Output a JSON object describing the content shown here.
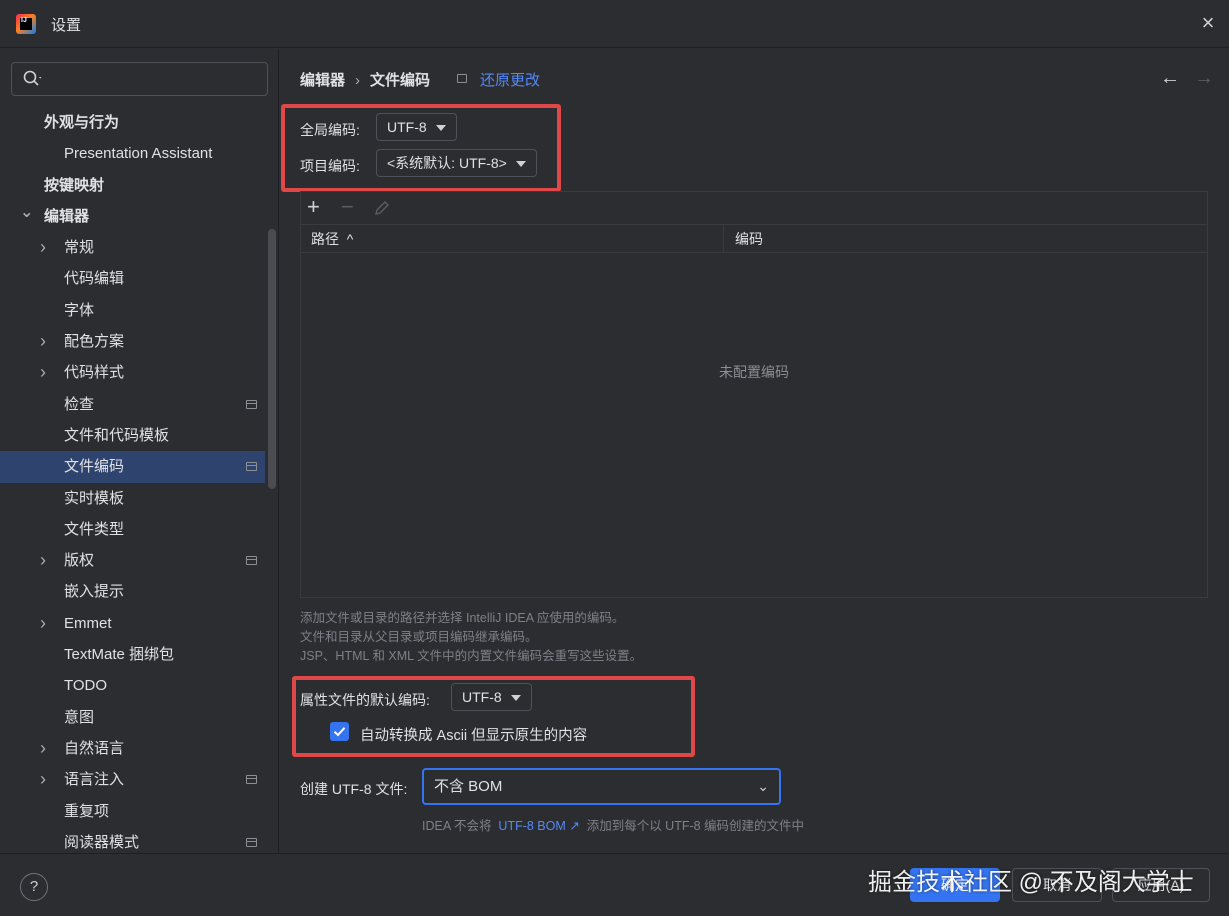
{
  "window": {
    "title": "设置"
  },
  "sidebar": {
    "search_placeholder": "",
    "items": [
      {
        "label": "外观与行为",
        "bold": true,
        "indent": 0,
        "chevron": ""
      },
      {
        "label": "Presentation Assistant",
        "bold": false,
        "indent": 1,
        "chevron": ""
      },
      {
        "label": "按键映射",
        "bold": true,
        "indent": 0,
        "chevron": ""
      },
      {
        "label": "编辑器",
        "bold": true,
        "indent": 0,
        "chevron": "down"
      },
      {
        "label": "常规",
        "bold": false,
        "indent": 1,
        "chevron": "right"
      },
      {
        "label": "代码编辑",
        "bold": false,
        "indent": 1,
        "chevron": ""
      },
      {
        "label": "字体",
        "bold": false,
        "indent": 1,
        "chevron": ""
      },
      {
        "label": "配色方案",
        "bold": false,
        "indent": 1,
        "chevron": "right"
      },
      {
        "label": "代码样式",
        "bold": false,
        "indent": 1,
        "chevron": "right"
      },
      {
        "label": "检查",
        "bold": false,
        "indent": 1,
        "chevron": "",
        "project_icon": true
      },
      {
        "label": "文件和代码模板",
        "bold": false,
        "indent": 1,
        "chevron": ""
      },
      {
        "label": "文件编码",
        "bold": false,
        "indent": 1,
        "chevron": "",
        "project_icon": true,
        "selected": true
      },
      {
        "label": "实时模板",
        "bold": false,
        "indent": 1,
        "chevron": ""
      },
      {
        "label": "文件类型",
        "bold": false,
        "indent": 1,
        "chevron": ""
      },
      {
        "label": "版权",
        "bold": false,
        "indent": 1,
        "chevron": "right",
        "project_icon": true
      },
      {
        "label": "嵌入提示",
        "bold": false,
        "indent": 1,
        "chevron": ""
      },
      {
        "label": "Emmet",
        "bold": false,
        "indent": 1,
        "chevron": "right"
      },
      {
        "label": "TextMate 捆绑包",
        "bold": false,
        "indent": 1,
        "chevron": ""
      },
      {
        "label": "TODO",
        "bold": false,
        "indent": 1,
        "chevron": ""
      },
      {
        "label": "意图",
        "bold": false,
        "indent": 1,
        "chevron": ""
      },
      {
        "label": "自然语言",
        "bold": false,
        "indent": 1,
        "chevron": "right"
      },
      {
        "label": "语言注入",
        "bold": false,
        "indent": 1,
        "chevron": "right",
        "project_icon": true
      },
      {
        "label": "重复项",
        "bold": false,
        "indent": 1,
        "chevron": ""
      },
      {
        "label": "阅读器模式",
        "bold": false,
        "indent": 1,
        "chevron": "",
        "project_icon": true
      }
    ]
  },
  "main": {
    "breadcrumb": {
      "parent": "编辑器",
      "separator": "›",
      "current": "文件编码"
    },
    "reset_link": "还原更改",
    "global_encoding": {
      "label": "全局编码:",
      "value": "UTF-8"
    },
    "project_encoding": {
      "label": "项目编码:",
      "value": "<系统默认: UTF-8>"
    },
    "table": {
      "add": "+",
      "remove": "−",
      "columns": [
        {
          "label": "路径",
          "sort": "^"
        },
        {
          "label": "编码"
        }
      ],
      "empty_text": "未配置编码"
    },
    "hints": [
      "添加文件或目录的路径并选择 IntelliJ IDEA 应使用的编码。",
      "文件和目录从父目录或项目编码继承编码。",
      "JSP、HTML 和 XML 文件中的内置文件编码会重写这些设置。"
    ],
    "properties_encoding": {
      "label": "属性文件的默认编码:",
      "value": "UTF-8"
    },
    "ascii_checkbox": {
      "label": "自动转换成 Ascii 但显示原生的内容",
      "checked": true
    },
    "bom": {
      "label": "创建 UTF-8 文件:",
      "value": "不含 BOM",
      "hint_prefix": "IDEA 不会将",
      "hint_link": "UTF-8 BOM",
      "hint_link_arrow": "↗",
      "hint_suffix": "添加到每个以 UTF-8 编码创建的文件中"
    }
  },
  "footer": {
    "help": "?",
    "ok": "确定",
    "cancel": "取消",
    "apply": "应用(A)"
  },
  "watermark": "掘金技术社区 @ 不及阁大学士",
  "colors": {
    "background": "#2b2d30",
    "accent": "#3574f0",
    "link": "#548af7",
    "highlight_box": "#e04848",
    "selection": "#2e436e"
  }
}
